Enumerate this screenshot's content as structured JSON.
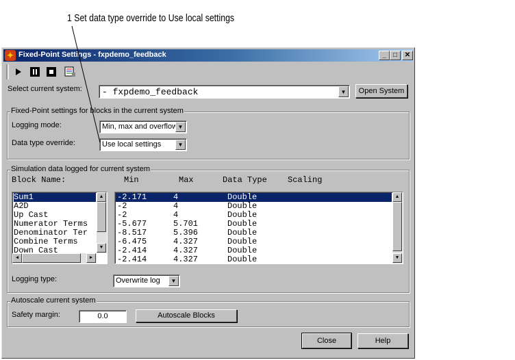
{
  "annotation": {
    "text": "1 Set data type override to Use local settings"
  },
  "window": {
    "title": "Fixed-Point Settings - fxpdemo_feedback"
  },
  "toolbar": {
    "icons": [
      "play-icon",
      "pause-icon",
      "stop-icon",
      "report-icon"
    ]
  },
  "system_select": {
    "label": "Select current system:",
    "value": "- fxpdemo_feedback",
    "open_button": "Open System"
  },
  "settings_group": {
    "legend": "Fixed-Point settings for blocks in the current system",
    "logging_mode_label": "Logging mode:",
    "logging_mode_value": "Min, max and overflow",
    "override_label": "Data type override:",
    "override_value": "Use local settings"
  },
  "sim_group": {
    "legend": "Simulation data logged for current system",
    "block_header": "Block Name:",
    "columns": [
      "Min",
      "Max",
      "Data Type",
      "Scaling"
    ],
    "blocks": [
      "Sum1",
      "A2D",
      "Up Cast",
      "Numerator Terms",
      "Denominator Ter",
      "Combine Terms",
      "Down Cast"
    ],
    "selected_block": 0,
    "rows": [
      {
        "min": "-2.171",
        "max": "4",
        "type": "Double",
        "scaling": ""
      },
      {
        "min": "-2",
        "max": "4",
        "type": "Double",
        "scaling": ""
      },
      {
        "min": "-2",
        "max": "4",
        "type": "Double",
        "scaling": ""
      },
      {
        "min": "-5.677",
        "max": "5.701",
        "type": "Double",
        "scaling": ""
      },
      {
        "min": "-8.517",
        "max": "5.396",
        "type": "Double",
        "scaling": ""
      },
      {
        "min": "-6.475",
        "max": "4.327",
        "type": "Double",
        "scaling": ""
      },
      {
        "min": "-2.414",
        "max": "4.327",
        "type": "Double",
        "scaling": ""
      },
      {
        "min": "-2.414",
        "max": "4.327",
        "type": "Double",
        "scaling": ""
      }
    ],
    "logging_type_label": "Logging type:",
    "logging_type_value": "Overwrite log"
  },
  "autoscale_group": {
    "legend": "Autoscale current system",
    "safety_label": "Safety margin:",
    "safety_value": "0.0",
    "autoscale_button": "Autoscale Blocks"
  },
  "footer": {
    "close": "Close",
    "help": "Help"
  },
  "colors": {
    "title_start": "#0a246a",
    "title_end": "#a6caf0",
    "selection": "#0a246a",
    "face": "#c0c0c0"
  }
}
